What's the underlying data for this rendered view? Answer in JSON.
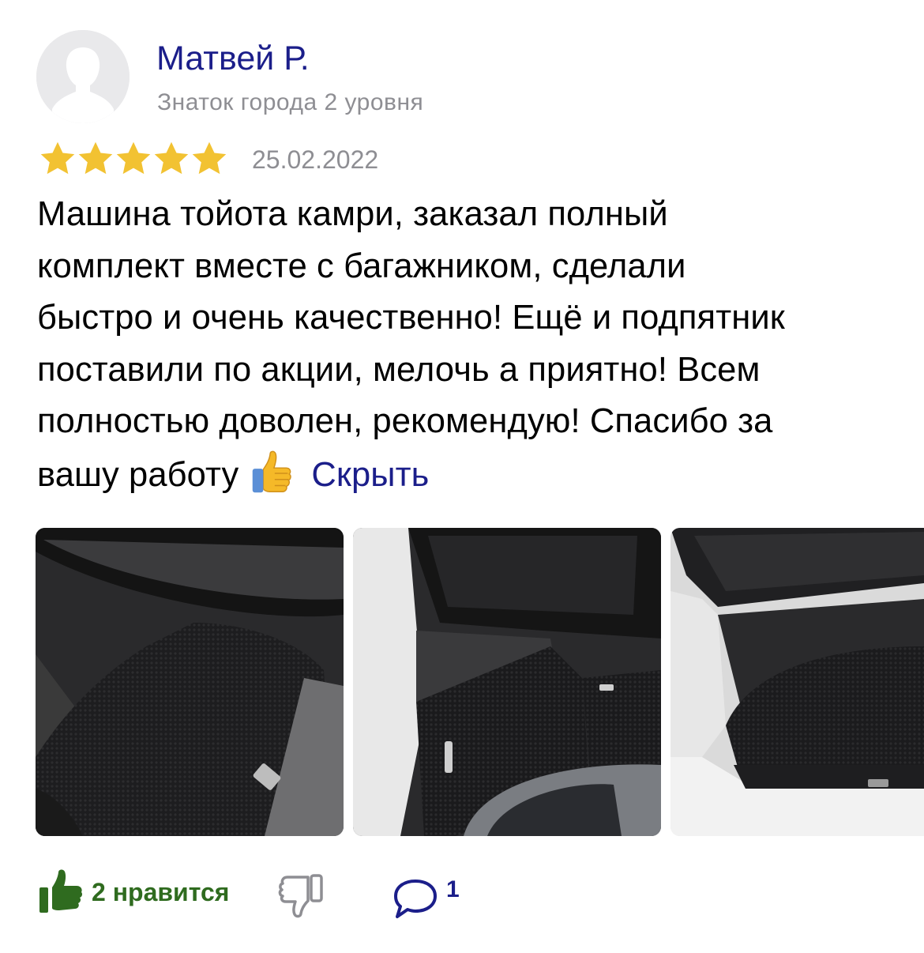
{
  "author": {
    "name": "Матвей Р.",
    "level": "Знаток города 2 уровня"
  },
  "rating": {
    "stars": 5,
    "max": 5,
    "color": "#f2c232"
  },
  "date": "25.02.2022",
  "review": {
    "lines": [
      "Машина тойота камри, заказал полный",
      "комплект вместе с багажником, сделали",
      "быстро и очень качественно! Ещё и подпятник",
      "поставили по акции, мелочь а приятно! Всем",
      "полностью доволен, рекомендую! Спасибо за",
      "вашу работу"
    ],
    "emoji": "thumbs-up-emoji",
    "hide_label": "Скрыть"
  },
  "photos": [
    {
      "icon": "car-floor-mat-photo"
    },
    {
      "icon": "car-rear-floor-mat-photo"
    },
    {
      "icon": "car-trunk-mat-photo"
    }
  ],
  "actions": {
    "like_label": "2 нравится",
    "comment_count": "1"
  },
  "colors": {
    "link": "#1b1e8a",
    "like": "#2f6b1f",
    "muted": "#8e8e93"
  }
}
